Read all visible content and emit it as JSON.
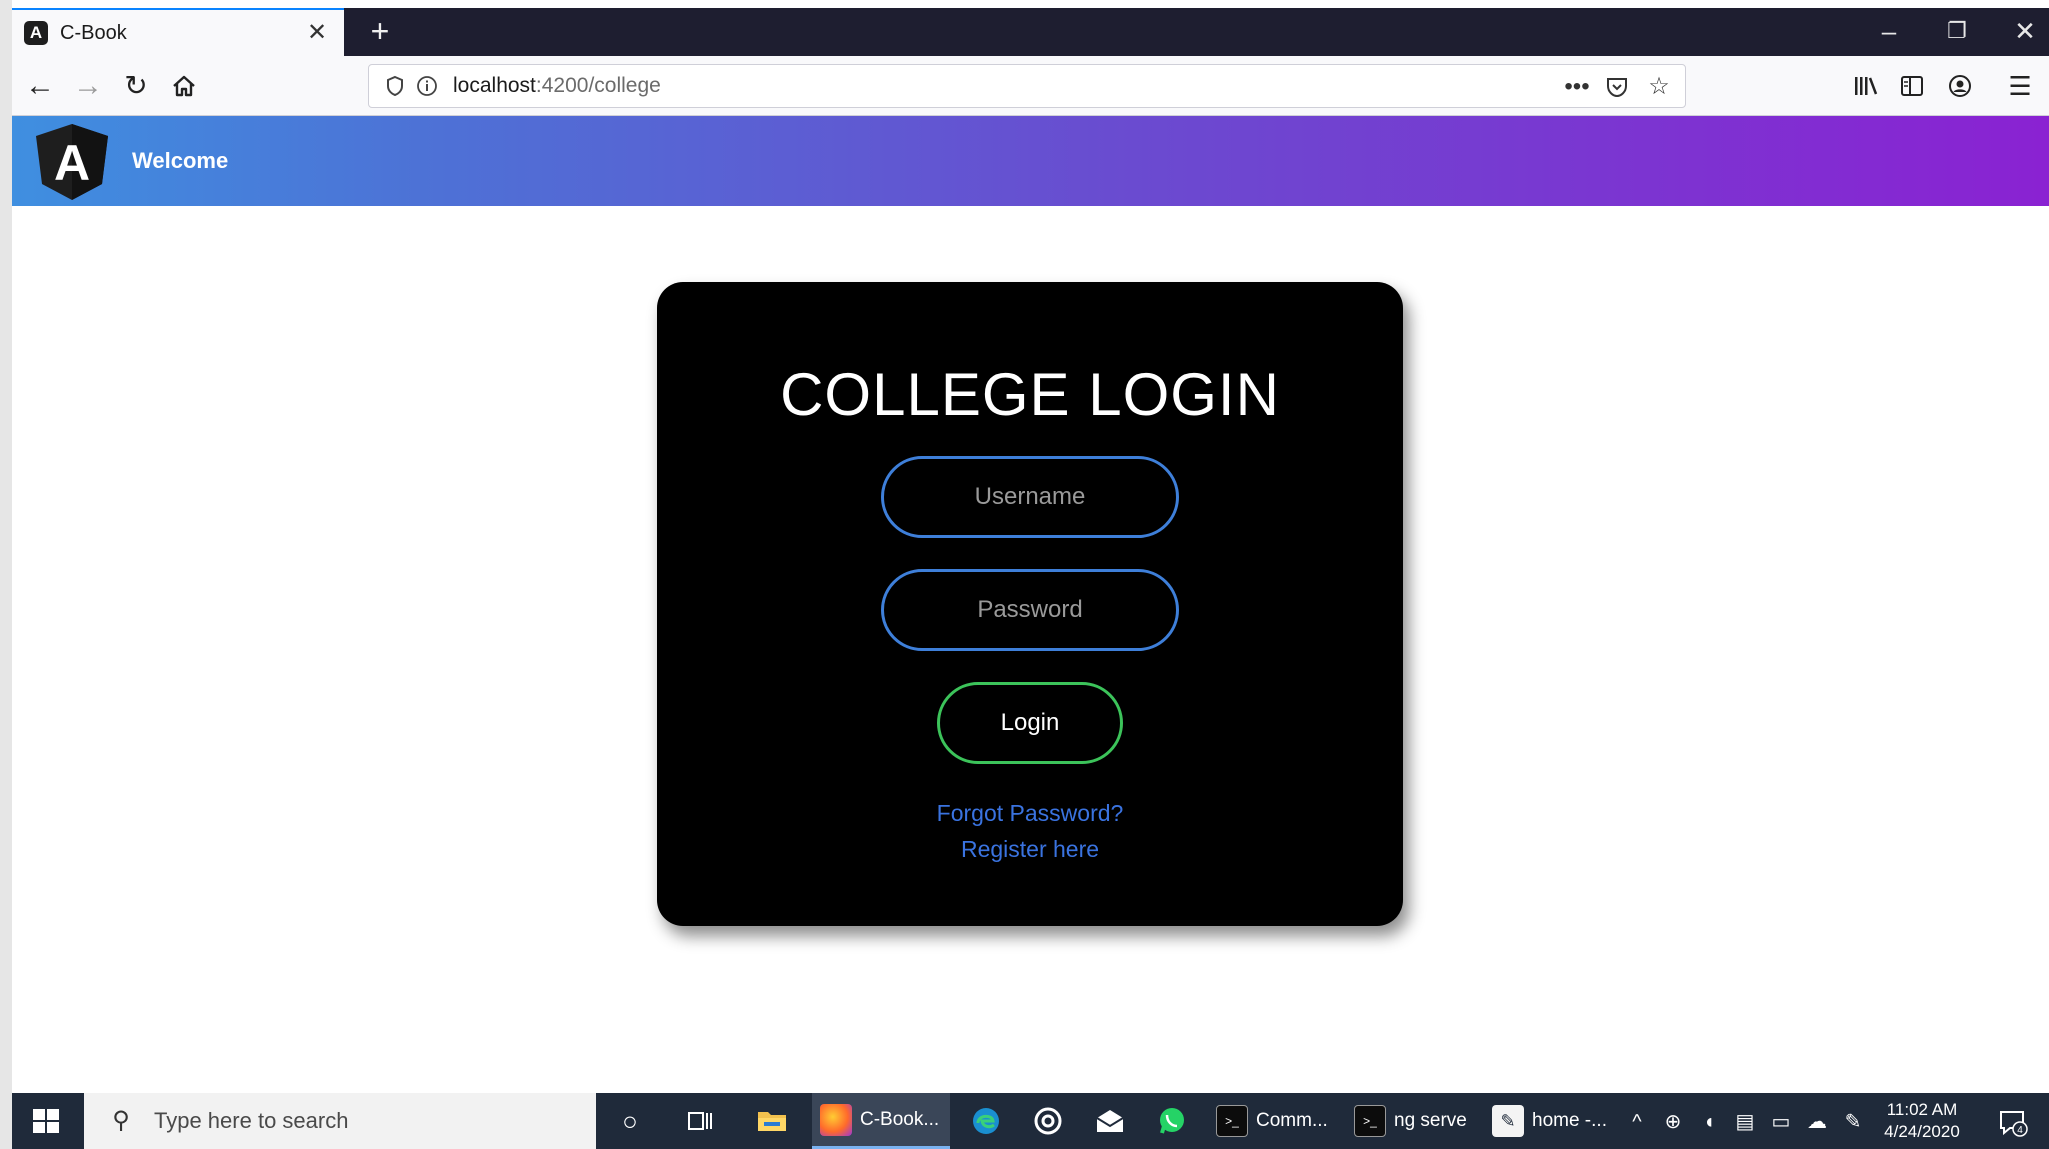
{
  "browser": {
    "tab_title": "C-Book",
    "tab_favicon": "A",
    "url_host": "localhost",
    "url_rest": ":4200/college"
  },
  "app": {
    "welcome": "Welcome",
    "logo_letter": "A"
  },
  "login": {
    "title": "COLLEGE LOGIN",
    "username_placeholder": "Username",
    "password_placeholder": "Password",
    "login_label": "Login",
    "forgot_label": "Forgot Password?",
    "register_label": "Register here"
  },
  "colors": {
    "header_gradient_start": "#3f8fe0",
    "header_gradient_end": "#8a22d2",
    "input_border": "#3e7fd9",
    "login_border": "#3cc35a",
    "link": "#3a73e0"
  },
  "taskbar": {
    "search_placeholder": "Type here to search",
    "apps": [
      {
        "label": "C-Book..."
      },
      {
        "label": "Comm..."
      },
      {
        "label": "ng serve"
      },
      {
        "label": "home -..."
      }
    ],
    "time": "11:02 AM",
    "date": "4/24/2020",
    "notification_count": "4"
  }
}
